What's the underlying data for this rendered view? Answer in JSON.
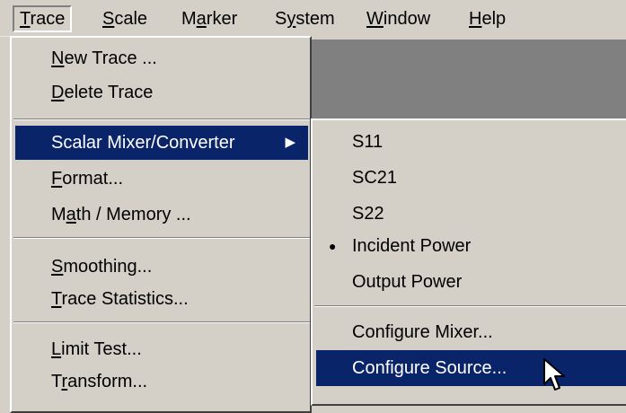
{
  "menubar": {
    "items": [
      {
        "label": "Trace",
        "active": true
      },
      {
        "label": "Scale",
        "active": false
      },
      {
        "label": "Marker",
        "active": false
      },
      {
        "label": "System",
        "active": false
      },
      {
        "label": "Window",
        "active": false
      },
      {
        "label": "Help",
        "active": false
      }
    ]
  },
  "trace_menu": {
    "items": [
      {
        "label": "New Trace ..."
      },
      {
        "label": "Delete Trace"
      },
      {
        "label": "Scalar Mixer/Converter",
        "selected": true,
        "has_submenu": true
      },
      {
        "label": "Format..."
      },
      {
        "label": "Math / Memory ..."
      },
      {
        "label": "Smoothing..."
      },
      {
        "label": "Trace Statistics..."
      },
      {
        "label": "Limit Test..."
      },
      {
        "label": "Transform..."
      }
    ]
  },
  "submenu": {
    "items": [
      {
        "label": "S11"
      },
      {
        "label": "SC21"
      },
      {
        "label": "S22"
      },
      {
        "label": "Incident Power",
        "checked": true
      },
      {
        "label": "Output Power"
      },
      {
        "label": "Configure Mixer..."
      },
      {
        "label": "Configure Source...",
        "selected": true
      }
    ]
  },
  "colors": {
    "menu_bg": "#d4d0c8",
    "highlight": "#0a246a",
    "highlight_text": "#ffffff",
    "app_bg": "#808080"
  },
  "icons": [
    "submenu-arrow-icon",
    "radio-bullet-icon",
    "mouse-pointer-icon"
  ]
}
